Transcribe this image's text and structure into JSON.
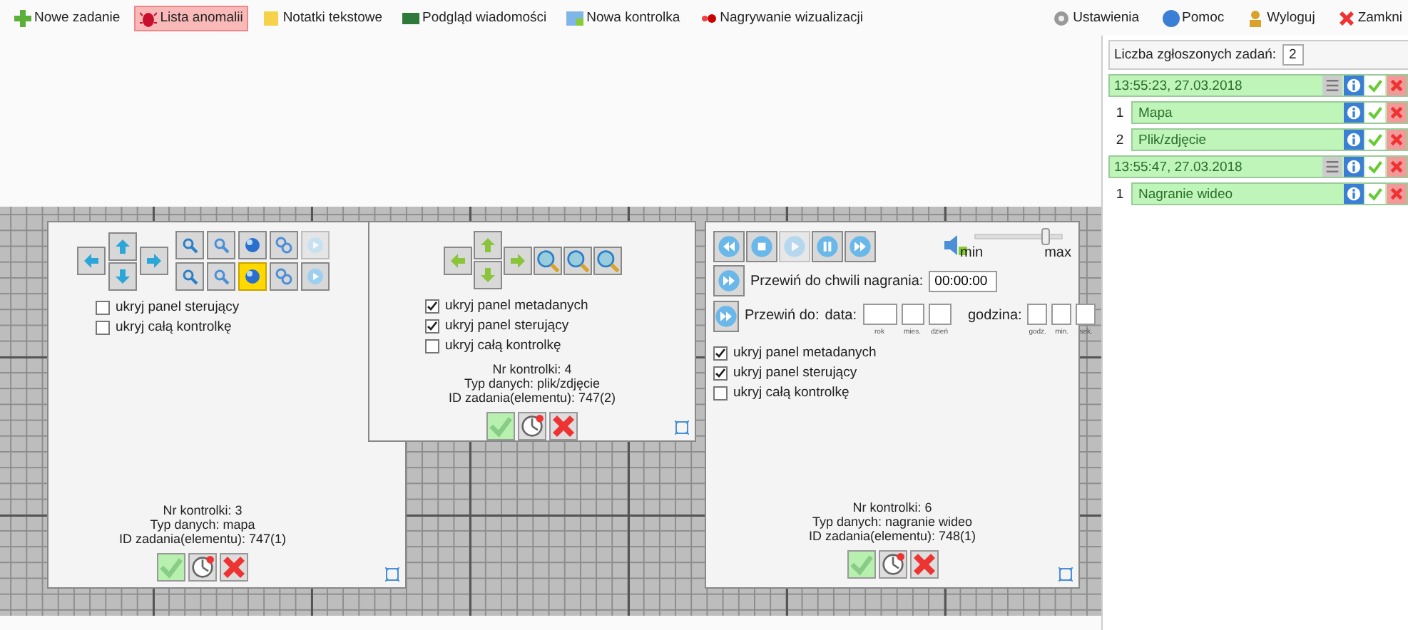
{
  "toolbar": {
    "items": [
      {
        "label": "Nowe zadanie",
        "selected": false
      },
      {
        "label": "Lista anomalii",
        "selected": true
      },
      {
        "label": "Notatki tekstowe",
        "selected": false
      },
      {
        "label": "Podgląd wiadomości",
        "selected": false
      },
      {
        "label": "Nowa kontrolka",
        "selected": false
      },
      {
        "label": "Nagrywanie wizualizacji",
        "selected": false
      }
    ],
    "right_items": [
      "Ustawienia",
      "Pomoc",
      "Wyloguj",
      "Zamkni"
    ]
  },
  "controls": [
    {
      "kind": "map",
      "tools": [
        {
          "selected": false,
          "disabled": false
        },
        {
          "selected": false,
          "disabled": false
        },
        {
          "selected": false,
          "disabled": false
        },
        {
          "selected": false,
          "disabled": false
        },
        {
          "selected": false,
          "disabled": true
        },
        {
          "selected": false,
          "disabled": false
        },
        {
          "selected": false,
          "disabled": false
        },
        {
          "selected": true,
          "disabled": false
        },
        {
          "selected": false,
          "disabled": false
        },
        {
          "selected": false,
          "disabled": false
        }
      ],
      "checkboxes": [
        {
          "label": "ukryj panel sterujący",
          "checked": false
        },
        {
          "label": "ukryj całą kontrolkę",
          "checked": false
        }
      ],
      "info": [
        "Nr kontrolki: 3",
        "Typ danych: mapa",
        "ID zadania(elementu): 747(1)"
      ]
    },
    {
      "kind": "image",
      "checkboxes": [
        {
          "label": "ukryj panel metadanych",
          "checked": true
        },
        {
          "label": "ukryj panel sterujący",
          "checked": true
        },
        {
          "label": "ukryj całą kontrolkę",
          "checked": false
        }
      ],
      "info": [
        "Nr kontrolki: 4",
        "Typ danych: plik/zdjęcie",
        "ID zadania(elementu): 747(2)"
      ]
    },
    {
      "kind": "video",
      "media_buttons": [
        {
          "disabled": false
        },
        {
          "disabled": false
        },
        {
          "disabled": true
        },
        {
          "disabled": false
        },
        {
          "disabled": false
        }
      ],
      "volume": {
        "level": 0.82,
        "min_label": "min",
        "max_label": "max"
      },
      "seek_label": "Przewiń do chwili nagrania:",
      "seek_value": "00:00:00",
      "goto_label": "Przewiń do:",
      "date_label": "data:",
      "date_hints": [
        "rok",
        "mies.",
        "dzień"
      ],
      "time_label": "godzina:",
      "time_hints": [
        "godz.",
        "min.",
        "sek."
      ],
      "checkboxes": [
        {
          "label": "ukryj panel metadanych",
          "checked": true
        },
        {
          "label": "ukryj panel sterujący",
          "checked": true
        },
        {
          "label": "ukryj całą kontrolkę",
          "checked": false
        }
      ],
      "info": [
        "Nr kontrolki: 6",
        "Typ danych: nagranie wideo",
        "ID zadania(elementu): 748(1)"
      ]
    }
  ],
  "tasks": {
    "count_label": "Liczba zgłoszonych zadań:",
    "count": "2",
    "groups": [
      {
        "timestamp": "13:55:23, 27.03.2018",
        "items": [
          {
            "number": "1",
            "name": "Mapa"
          },
          {
            "number": "2",
            "name": "Plik/zdjęcie"
          }
        ]
      },
      {
        "timestamp": "13:55:47, 27.03.2018",
        "items": [
          {
            "number": "1",
            "name": "Nagranie wideo"
          }
        ]
      }
    ]
  }
}
